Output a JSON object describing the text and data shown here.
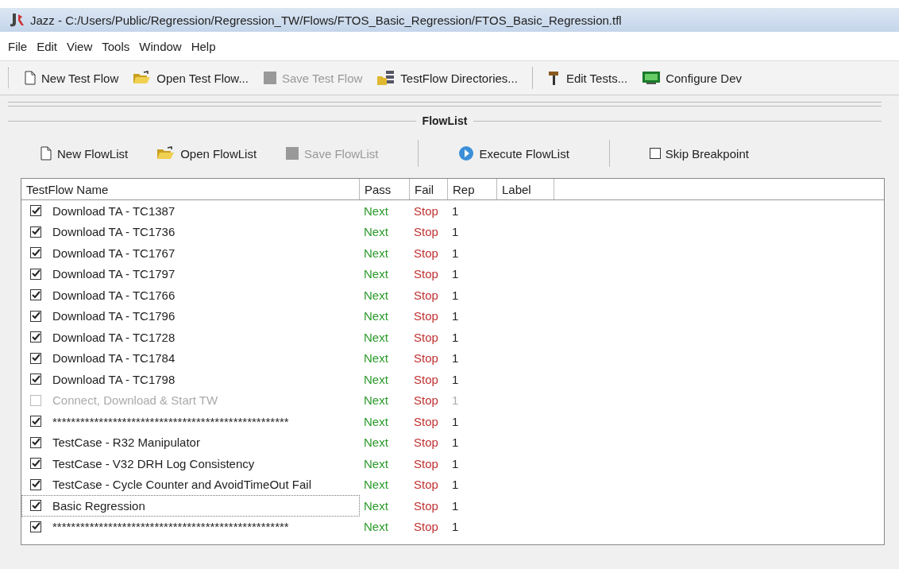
{
  "window": {
    "title": "Jazz - C:/Users/Public/Regression/Regression_TW/Flows/FTOS_Basic_Regression/FTOS_Basic_Regression.tfl"
  },
  "menu": [
    {
      "label": "File"
    },
    {
      "label": "Edit"
    },
    {
      "label": "View"
    },
    {
      "label": "Tools"
    },
    {
      "label": "Window"
    },
    {
      "label": "Help"
    }
  ],
  "toolbar": [
    {
      "kind": "new",
      "label": "New Test Flow",
      "disabled": false
    },
    {
      "kind": "open",
      "label": "Open Test Flow...",
      "disabled": false
    },
    {
      "kind": "save",
      "label": "Save Test Flow",
      "disabled": true
    },
    {
      "kind": "dirs",
      "label": "TestFlow Directories...",
      "disabled": false
    },
    {
      "kind": "sep"
    },
    {
      "kind": "edit",
      "label": "Edit Tests...",
      "disabled": false
    },
    {
      "kind": "config",
      "label": "Configure Dev",
      "disabled": false
    }
  ],
  "flowlist": {
    "title": "FlowList",
    "toolbar": [
      {
        "kind": "new",
        "label": "New FlowList",
        "disabled": false
      },
      {
        "kind": "open",
        "label": "Open FlowList",
        "disabled": false
      },
      {
        "kind": "save",
        "label": "Save FlowList",
        "disabled": true
      },
      {
        "kind": "sep"
      },
      {
        "kind": "execute",
        "label": "Execute FlowList",
        "disabled": false
      },
      {
        "kind": "sep"
      },
      {
        "kind": "checkbox",
        "label": "Skip Breakpoint",
        "checked": false
      }
    ],
    "table": {
      "columns": [
        "TestFlow Name",
        "Pass",
        "Fail",
        "Rep",
        "Label"
      ],
      "rows": [
        {
          "name": "Download TA - TC1387",
          "pass": "Next",
          "fail": "Stop",
          "rep": "1",
          "checked": true,
          "disabled": false,
          "focused": false
        },
        {
          "name": "Download TA - TC1736",
          "pass": "Next",
          "fail": "Stop",
          "rep": "1",
          "checked": true,
          "disabled": false,
          "focused": false
        },
        {
          "name": "Download TA - TC1767",
          "pass": "Next",
          "fail": "Stop",
          "rep": "1",
          "checked": true,
          "disabled": false,
          "focused": false
        },
        {
          "name": "Download TA - TC1797",
          "pass": "Next",
          "fail": "Stop",
          "rep": "1",
          "checked": true,
          "disabled": false,
          "focused": false
        },
        {
          "name": "Download TA - TC1766",
          "pass": "Next",
          "fail": "Stop",
          "rep": "1",
          "checked": true,
          "disabled": false,
          "focused": false
        },
        {
          "name": "Download TA - TC1796",
          "pass": "Next",
          "fail": "Stop",
          "rep": "1",
          "checked": true,
          "disabled": false,
          "focused": false
        },
        {
          "name": "Download TA - TC1728",
          "pass": "Next",
          "fail": "Stop",
          "rep": "1",
          "checked": true,
          "disabled": false,
          "focused": false
        },
        {
          "name": "Download TA - TC1784",
          "pass": "Next",
          "fail": "Stop",
          "rep": "1",
          "checked": true,
          "disabled": false,
          "focused": false
        },
        {
          "name": "Download TA - TC1798",
          "pass": "Next",
          "fail": "Stop",
          "rep": "1",
          "checked": true,
          "disabled": false,
          "focused": false
        },
        {
          "name": "Connect, Download & Start TW",
          "pass": "Next",
          "fail": "Stop",
          "rep": "1",
          "checked": false,
          "disabled": true,
          "focused": false
        },
        {
          "name": "***************************************************",
          "pass": "Next",
          "fail": "Stop",
          "rep": "1",
          "checked": true,
          "disabled": false,
          "focused": false
        },
        {
          "name": "TestCase - R32 Manipulator",
          "pass": "Next",
          "fail": "Stop",
          "rep": "1",
          "checked": true,
          "disabled": false,
          "focused": false
        },
        {
          "name": "TestCase - V32 DRH Log Consistency",
          "pass": "Next",
          "fail": "Stop",
          "rep": "1",
          "checked": true,
          "disabled": false,
          "focused": false
        },
        {
          "name": "TestCase - Cycle Counter and AvoidTimeOut Fail",
          "pass": "Next",
          "fail": "Stop",
          "rep": "1",
          "checked": true,
          "disabled": false,
          "focused": false
        },
        {
          "name": "Basic Regression",
          "pass": "Next",
          "fail": "Stop",
          "rep": "1",
          "checked": true,
          "disabled": false,
          "focused": true
        },
        {
          "name": "***************************************************",
          "pass": "Next",
          "fail": "Stop",
          "rep": "1",
          "checked": true,
          "disabled": false,
          "focused": false
        }
      ]
    }
  }
}
